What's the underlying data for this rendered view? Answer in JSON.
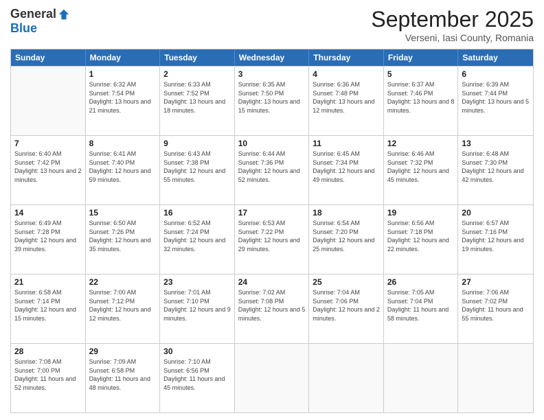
{
  "logo": {
    "general": "General",
    "blue": "Blue"
  },
  "title": "September 2025",
  "subtitle": "Verseni, Iasi County, Romania",
  "header_days": [
    "Sunday",
    "Monday",
    "Tuesday",
    "Wednesday",
    "Thursday",
    "Friday",
    "Saturday"
  ],
  "weeks": [
    [
      {
        "day": "",
        "empty": true
      },
      {
        "day": "1",
        "sunrise": "Sunrise: 6:32 AM",
        "sunset": "Sunset: 7:54 PM",
        "daylight": "Daylight: 13 hours and 21 minutes."
      },
      {
        "day": "2",
        "sunrise": "Sunrise: 6:33 AM",
        "sunset": "Sunset: 7:52 PM",
        "daylight": "Daylight: 13 hours and 18 minutes."
      },
      {
        "day": "3",
        "sunrise": "Sunrise: 6:35 AM",
        "sunset": "Sunset: 7:50 PM",
        "daylight": "Daylight: 13 hours and 15 minutes."
      },
      {
        "day": "4",
        "sunrise": "Sunrise: 6:36 AM",
        "sunset": "Sunset: 7:48 PM",
        "daylight": "Daylight: 13 hours and 12 minutes."
      },
      {
        "day": "5",
        "sunrise": "Sunrise: 6:37 AM",
        "sunset": "Sunset: 7:46 PM",
        "daylight": "Daylight: 13 hours and 8 minutes."
      },
      {
        "day": "6",
        "sunrise": "Sunrise: 6:39 AM",
        "sunset": "Sunset: 7:44 PM",
        "daylight": "Daylight: 13 hours and 5 minutes."
      }
    ],
    [
      {
        "day": "7",
        "sunrise": "Sunrise: 6:40 AM",
        "sunset": "Sunset: 7:42 PM",
        "daylight": "Daylight: 13 hours and 2 minutes."
      },
      {
        "day": "8",
        "sunrise": "Sunrise: 6:41 AM",
        "sunset": "Sunset: 7:40 PM",
        "daylight": "Daylight: 12 hours and 59 minutes."
      },
      {
        "day": "9",
        "sunrise": "Sunrise: 6:43 AM",
        "sunset": "Sunset: 7:38 PM",
        "daylight": "Daylight: 12 hours and 55 minutes."
      },
      {
        "day": "10",
        "sunrise": "Sunrise: 6:44 AM",
        "sunset": "Sunset: 7:36 PM",
        "daylight": "Daylight: 12 hours and 52 minutes."
      },
      {
        "day": "11",
        "sunrise": "Sunrise: 6:45 AM",
        "sunset": "Sunset: 7:34 PM",
        "daylight": "Daylight: 12 hours and 49 minutes."
      },
      {
        "day": "12",
        "sunrise": "Sunrise: 6:46 AM",
        "sunset": "Sunset: 7:32 PM",
        "daylight": "Daylight: 12 hours and 45 minutes."
      },
      {
        "day": "13",
        "sunrise": "Sunrise: 6:48 AM",
        "sunset": "Sunset: 7:30 PM",
        "daylight": "Daylight: 12 hours and 42 minutes."
      }
    ],
    [
      {
        "day": "14",
        "sunrise": "Sunrise: 6:49 AM",
        "sunset": "Sunset: 7:28 PM",
        "daylight": "Daylight: 12 hours and 39 minutes."
      },
      {
        "day": "15",
        "sunrise": "Sunrise: 6:50 AM",
        "sunset": "Sunset: 7:26 PM",
        "daylight": "Daylight: 12 hours and 35 minutes."
      },
      {
        "day": "16",
        "sunrise": "Sunrise: 6:52 AM",
        "sunset": "Sunset: 7:24 PM",
        "daylight": "Daylight: 12 hours and 32 minutes."
      },
      {
        "day": "17",
        "sunrise": "Sunrise: 6:53 AM",
        "sunset": "Sunset: 7:22 PM",
        "daylight": "Daylight: 12 hours and 29 minutes."
      },
      {
        "day": "18",
        "sunrise": "Sunrise: 6:54 AM",
        "sunset": "Sunset: 7:20 PM",
        "daylight": "Daylight: 12 hours and 25 minutes."
      },
      {
        "day": "19",
        "sunrise": "Sunrise: 6:56 AM",
        "sunset": "Sunset: 7:18 PM",
        "daylight": "Daylight: 12 hours and 22 minutes."
      },
      {
        "day": "20",
        "sunrise": "Sunrise: 6:57 AM",
        "sunset": "Sunset: 7:16 PM",
        "daylight": "Daylight: 12 hours and 19 minutes."
      }
    ],
    [
      {
        "day": "21",
        "sunrise": "Sunrise: 6:58 AM",
        "sunset": "Sunset: 7:14 PM",
        "daylight": "Daylight: 12 hours and 15 minutes."
      },
      {
        "day": "22",
        "sunrise": "Sunrise: 7:00 AM",
        "sunset": "Sunset: 7:12 PM",
        "daylight": "Daylight: 12 hours and 12 minutes."
      },
      {
        "day": "23",
        "sunrise": "Sunrise: 7:01 AM",
        "sunset": "Sunset: 7:10 PM",
        "daylight": "Daylight: 12 hours and 9 minutes."
      },
      {
        "day": "24",
        "sunrise": "Sunrise: 7:02 AM",
        "sunset": "Sunset: 7:08 PM",
        "daylight": "Daylight: 12 hours and 5 minutes."
      },
      {
        "day": "25",
        "sunrise": "Sunrise: 7:04 AM",
        "sunset": "Sunset: 7:06 PM",
        "daylight": "Daylight: 12 hours and 2 minutes."
      },
      {
        "day": "26",
        "sunrise": "Sunrise: 7:05 AM",
        "sunset": "Sunset: 7:04 PM",
        "daylight": "Daylight: 11 hours and 58 minutes."
      },
      {
        "day": "27",
        "sunrise": "Sunrise: 7:06 AM",
        "sunset": "Sunset: 7:02 PM",
        "daylight": "Daylight: 11 hours and 55 minutes."
      }
    ],
    [
      {
        "day": "28",
        "sunrise": "Sunrise: 7:08 AM",
        "sunset": "Sunset: 7:00 PM",
        "daylight": "Daylight: 11 hours and 52 minutes."
      },
      {
        "day": "29",
        "sunrise": "Sunrise: 7:09 AM",
        "sunset": "Sunset: 6:58 PM",
        "daylight": "Daylight: 11 hours and 48 minutes."
      },
      {
        "day": "30",
        "sunrise": "Sunrise: 7:10 AM",
        "sunset": "Sunset: 6:56 PM",
        "daylight": "Daylight: 11 hours and 45 minutes."
      },
      {
        "day": "",
        "empty": true
      },
      {
        "day": "",
        "empty": true
      },
      {
        "day": "",
        "empty": true
      },
      {
        "day": "",
        "empty": true
      }
    ]
  ]
}
